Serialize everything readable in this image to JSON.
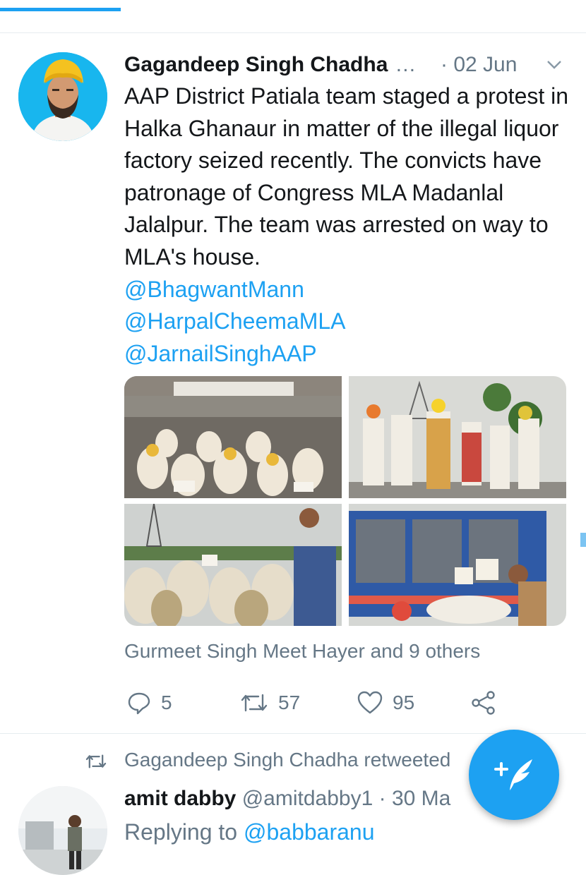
{
  "tweet": {
    "author": "Gagandeep Singh Chadha",
    "ellipsis": "…",
    "date_sep": "·",
    "date": "02 Jun",
    "text": "AAP District Patiala team staged a protest in Halka Ghanaur in matter of the illegal liquor factory seized recently. The convicts have patronage of Congress MLA Madanlal Jalalpur. The team was arrested on way to MLA's house.",
    "mentions": [
      "@BhagwantMann",
      "@HarpalCheemaMLA",
      "@JarnailSinghAAP"
    ],
    "liked_by": "Gurmeet Singh Meet Hayer and 9 others",
    "stats": {
      "replies": "5",
      "retweets": "57",
      "likes": "95"
    }
  },
  "retweet_notice": "Gagandeep Singh Chadha retweeted",
  "next_tweet": {
    "author": "amit dabby",
    "handle": "@amitdabby1",
    "date_sep": "·",
    "date_partial": "30 Ma",
    "replying_prefix": "Replying to",
    "replying_handle": "@babbaranu"
  },
  "colors": {
    "accent": "#1da1f2",
    "secondary_text": "#657786",
    "primary_text": "#14171a"
  },
  "icons": [
    "reply-icon",
    "retweet-icon",
    "like-icon",
    "share-icon",
    "chevron-down-icon",
    "compose-tweet-icon"
  ]
}
